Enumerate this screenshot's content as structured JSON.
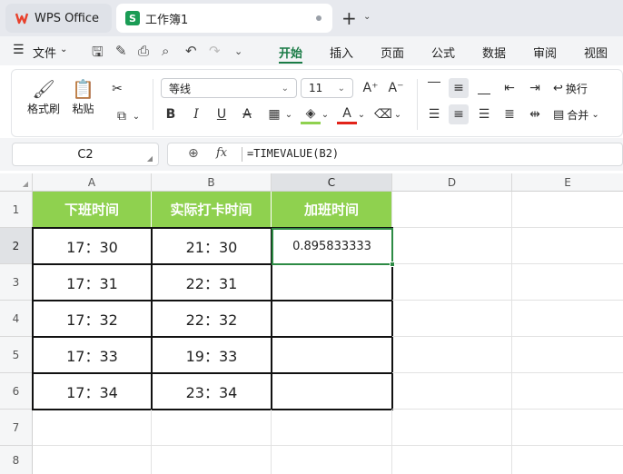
{
  "tabs": [
    {
      "label": "WPS Office"
    },
    {
      "label": "工作簿1"
    }
  ],
  "menu": {
    "file": "文件",
    "items": [
      "开始",
      "插入",
      "页面",
      "公式",
      "数据",
      "审阅",
      "视图"
    ]
  },
  "ribbon": {
    "format_painter": "格式刷",
    "paste": "粘贴",
    "font_name": "等线",
    "font_size": "11",
    "wrap": "换行",
    "merge": "合并"
  },
  "formula_bar": {
    "cell_ref": "C2",
    "fx": "fx",
    "formula": "=TIMEVALUE(B2)"
  },
  "sheet": {
    "columns": [
      "A",
      "B",
      "C",
      "D",
      "E"
    ],
    "rows": [
      "1",
      "2",
      "3",
      "4",
      "5",
      "6",
      "7",
      "8"
    ],
    "headers": [
      "下班时间",
      "实际打卡时间",
      "加班时间"
    ],
    "data": [
      [
        "17：30",
        "21：30",
        "0.895833333"
      ],
      [
        "17：31",
        "22：31",
        ""
      ],
      [
        "17：32",
        "22：32",
        ""
      ],
      [
        "17：33",
        "19：33",
        ""
      ],
      [
        "17：34",
        "23：34",
        ""
      ]
    ]
  },
  "colors": {
    "accent": "#1a7b46",
    "header_fill": "#8fd14f",
    "selection": "#2d8a44"
  }
}
